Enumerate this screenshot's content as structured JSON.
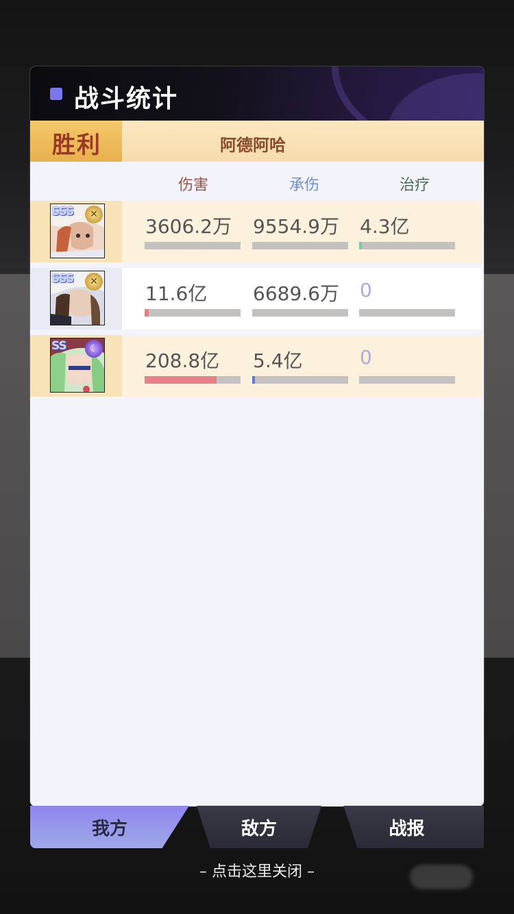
{
  "header": {
    "title": "战斗统计"
  },
  "result": {
    "label": "胜利",
    "player_name": "阿德阿哈"
  },
  "columns": {
    "damage": "伤害",
    "taken": "承伤",
    "heal": "治疗"
  },
  "rows": [
    {
      "star_rank": "SSS",
      "class_icon": "crossed-swords-icon",
      "damage": {
        "text": "3606.2万",
        "fraction": 0.0
      },
      "taken": {
        "text": "9554.9万",
        "fraction": 0.0
      },
      "heal": {
        "text": "4.3亿",
        "fraction": 0.02
      }
    },
    {
      "star_rank": "SSS",
      "class_icon": "crossed-swords-icon",
      "damage": {
        "text": "11.6亿",
        "fraction": 0.04
      },
      "taken": {
        "text": "6689.6万",
        "fraction": 0.0
      },
      "heal": {
        "text": "0",
        "fraction": 0.0
      }
    },
    {
      "star_rank": "SS",
      "class_icon": "moon-icon",
      "damage": {
        "text": "208.8亿",
        "fraction": 0.75
      },
      "taken": {
        "text": "5.4亿",
        "fraction": 0.02
      },
      "heal": {
        "text": "0",
        "fraction": 0.0
      }
    }
  ],
  "tabs": {
    "my": "我方",
    "enemy": "敌方",
    "report": "战报"
  },
  "close_hint": "– 点击这里关闭 –",
  "colors": {
    "accent": "#7a76ee",
    "damage_bar": "#e8808a",
    "taken_bar": "#5a78d8",
    "heal_bar": "#7bc9a0"
  }
}
